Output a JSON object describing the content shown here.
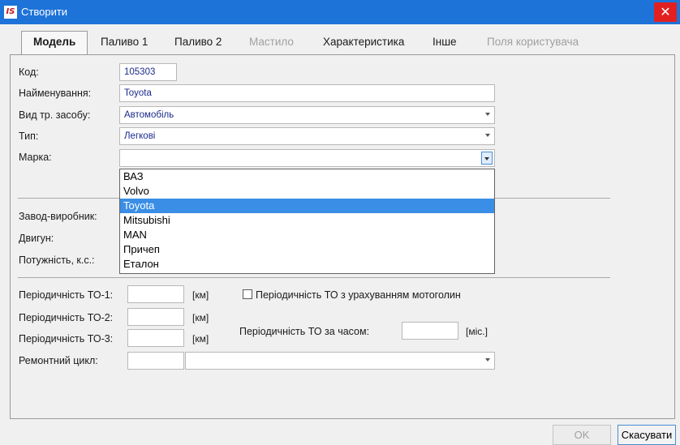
{
  "window": {
    "icon_text": "IS",
    "title": "Створити",
    "close_glyph": "✕"
  },
  "tabs": [
    {
      "label": "Модель",
      "state": "active"
    },
    {
      "label": "Паливо 1",
      "state": "normal"
    },
    {
      "label": "Паливо 2",
      "state": "normal"
    },
    {
      "label": "Мастило",
      "state": "disabled"
    },
    {
      "label": "Характеристика",
      "state": "normal"
    },
    {
      "label": "Інше",
      "state": "normal"
    },
    {
      "label": "Поля користувача",
      "state": "disabled"
    }
  ],
  "form": {
    "code_label": "Код:",
    "code_value": "105303",
    "name_label": "Найменування:",
    "name_value": "Toyota",
    "vehicle_type_label": "Вид тр. засобу:",
    "vehicle_type_value": "Автомобіль",
    "type_label": "Тип:",
    "type_value": "Легкові",
    "brand_label": "Марка:",
    "brand_value": "",
    "manufacturer_label": "Завод-виробник:",
    "engine_label": "Двигун:",
    "power_label": "Потужність, к.с.:"
  },
  "brand_options": [
    {
      "label": "ВАЗ",
      "selected": false
    },
    {
      "label": "Volvo",
      "selected": false
    },
    {
      "label": "Toyota",
      "selected": true
    },
    {
      "label": "Mitsubishi",
      "selected": false
    },
    {
      "label": "MAN",
      "selected": false
    },
    {
      "label": "Причеп",
      "selected": false
    },
    {
      "label": "Еталон",
      "selected": false
    }
  ],
  "maintenance": {
    "to1_label": "Періодичність ТО-1:",
    "to2_label": "Періодичність ТО-2:",
    "to3_label": "Періодичність ТО-3:",
    "unit_km": "[км]",
    "motohours_label": "Періодичність ТО з урахуванням мотоголин",
    "motohours_checked": false,
    "time_label": "Періодичність ТО за часом:",
    "unit_month": "[міс.]",
    "repair_cycle_label": "Ремонтний цикл:"
  },
  "buttons": {
    "ok": "OK",
    "cancel": "Скасувати"
  },
  "colors": {
    "titlebar": "#1e73d8",
    "close": "#e32020",
    "selection": "#3a8ee6"
  }
}
